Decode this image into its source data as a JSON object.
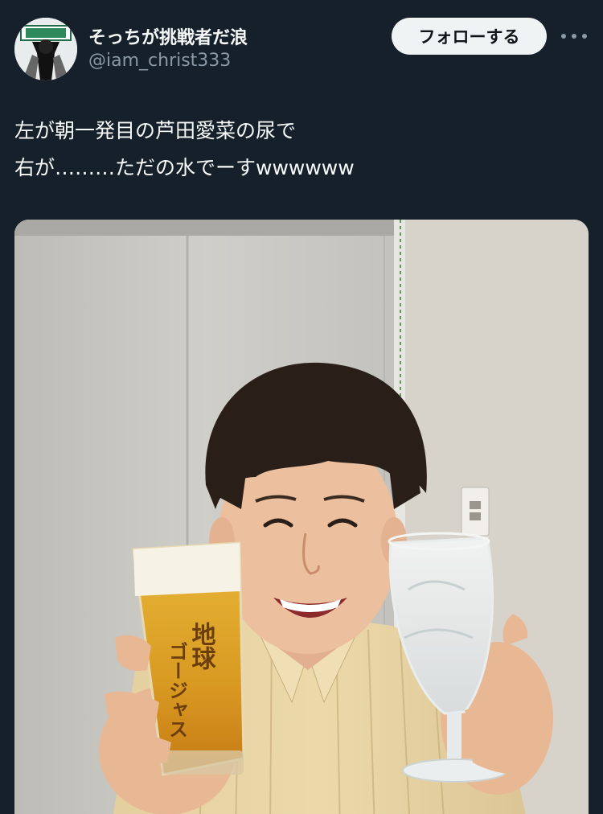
{
  "post": {
    "author": {
      "display_name": "そっちが挑戦者だ浪",
      "handle": "@iam_christ333"
    },
    "follow_label": "フォローする",
    "text_lines": [
      "左が朝一発目の芦田愛菜の尿で",
      "右が………ただの水でーすwwwwww"
    ]
  },
  "photo": {
    "glass_print": [
      "地球",
      "ゴージャス"
    ]
  },
  "colors": {
    "background": "#15202b",
    "text_primary": "#f7f9f9",
    "text_secondary": "#8b98a5",
    "follow_button_bg": "#eff3f4"
  },
  "icons": {
    "more": "more-horizontal-icon"
  }
}
